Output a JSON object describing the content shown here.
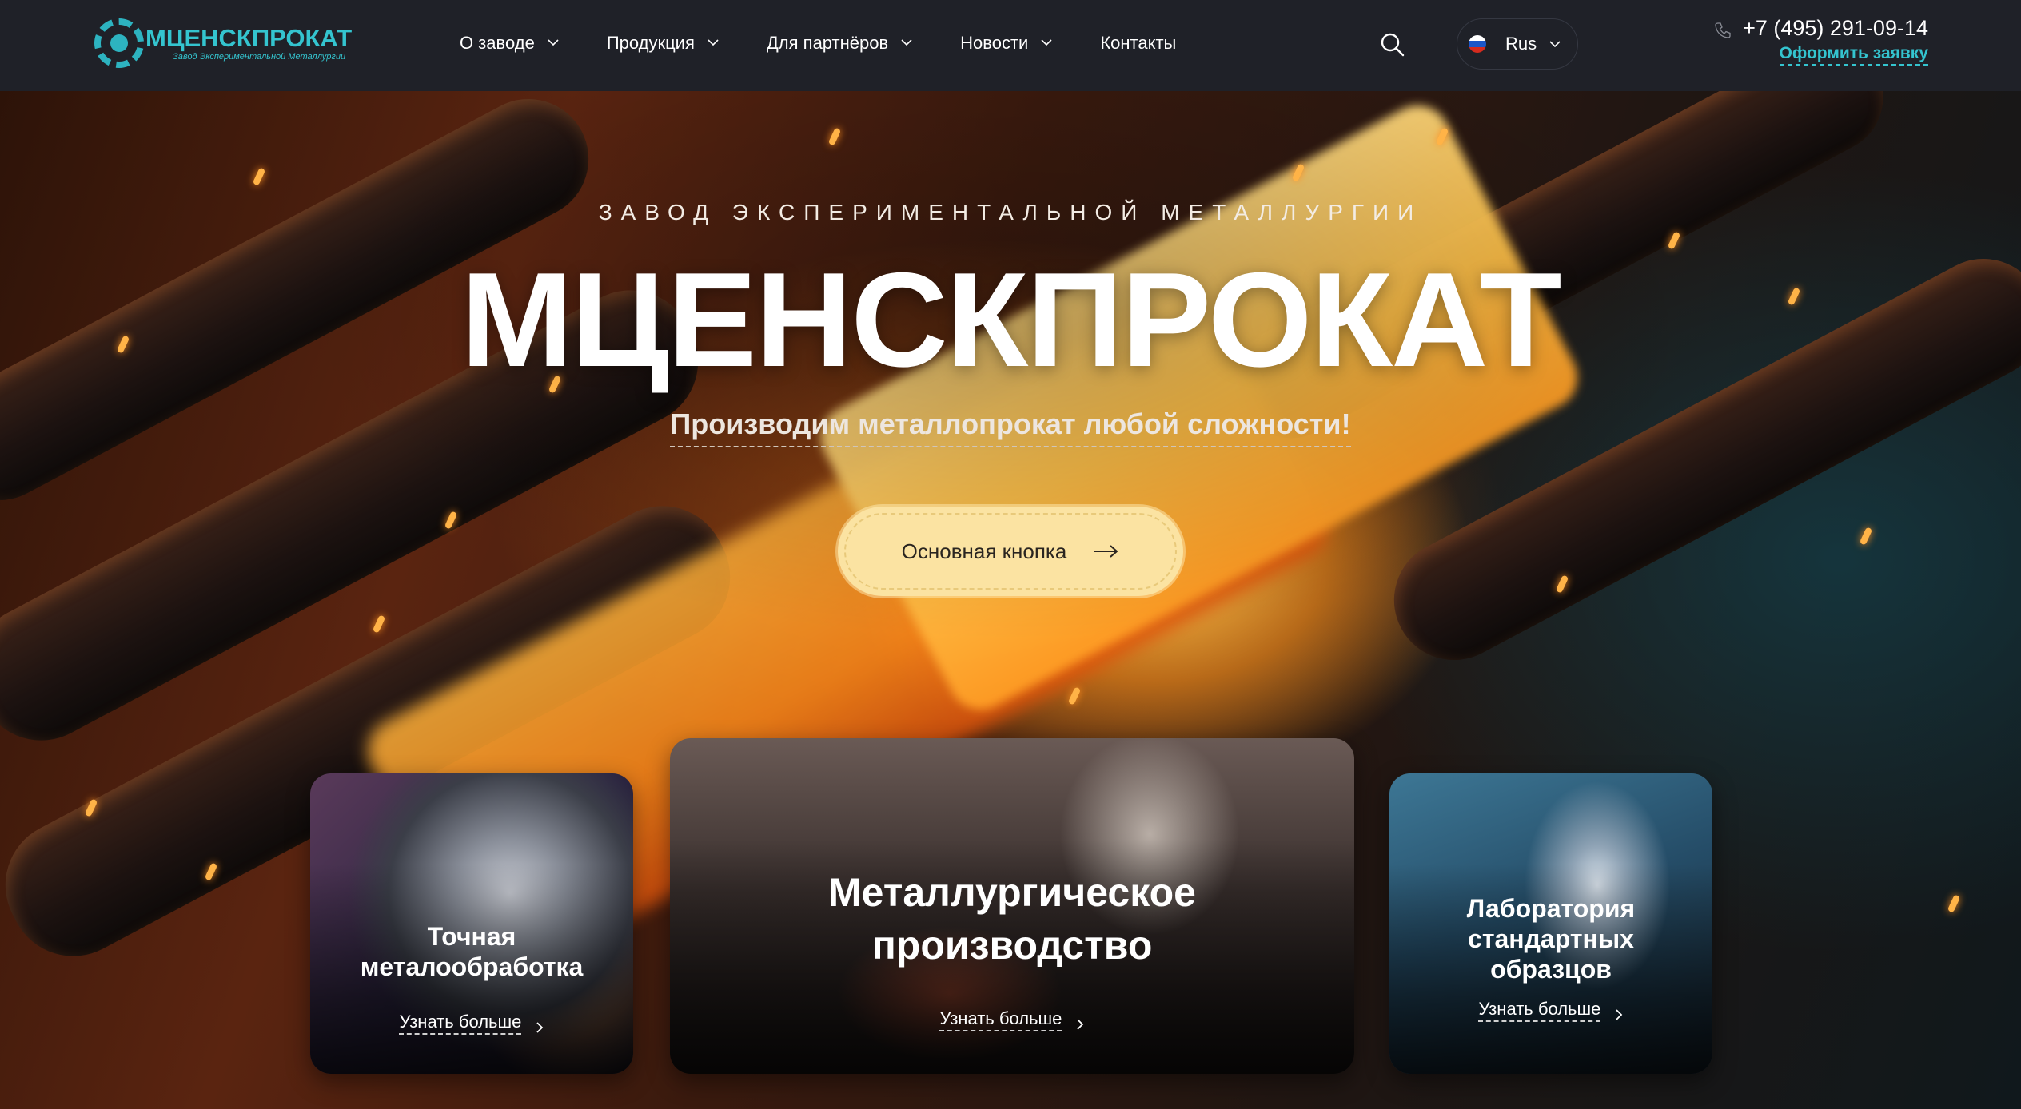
{
  "header": {
    "logo_title": "МЦЕНСКПРОКАТ",
    "logo_subtitle": "Завод Экспериментальной Металлургии",
    "nav": [
      {
        "label": "О заводе",
        "has_dropdown": true
      },
      {
        "label": "Продукция",
        "has_dropdown": true
      },
      {
        "label": "Для партнёров",
        "has_dropdown": true
      },
      {
        "label": "Новости",
        "has_dropdown": true
      },
      {
        "label": "Контакты",
        "has_dropdown": false
      }
    ],
    "language": "Rus",
    "phone": "+7 (495) 291-09-14",
    "order_link": "Оформить заявку"
  },
  "hero": {
    "subtitle": "ЗАВОД ЭКСПЕРИМЕНТАЛЬНОЙ МЕТАЛЛУРГИИ",
    "title": "МЦЕНСКПРОКАТ",
    "tagline": "Производим металлопрокат любой сложности!",
    "cta_label": "Основная кнопка"
  },
  "cards": [
    {
      "title_lines": [
        "Точная",
        "металообработка"
      ],
      "link": "Узнать больше"
    },
    {
      "title_lines": [
        "Металлургическое",
        "производство"
      ],
      "link": "Узнать больше"
    },
    {
      "title_lines": [
        "Лаборатория",
        "стандартных",
        "образцов"
      ],
      "link": "Узнать больше"
    }
  ],
  "colors": {
    "accent": "#34c4cf",
    "header_bg": "#1f2128",
    "cta_bg": "#fbe3a2"
  },
  "icons": [
    "gear-logo-icon",
    "chevron-down-icon",
    "search-icon",
    "russia-flag-icon",
    "phone-icon",
    "arrow-right-icon",
    "chevron-right-icon"
  ]
}
